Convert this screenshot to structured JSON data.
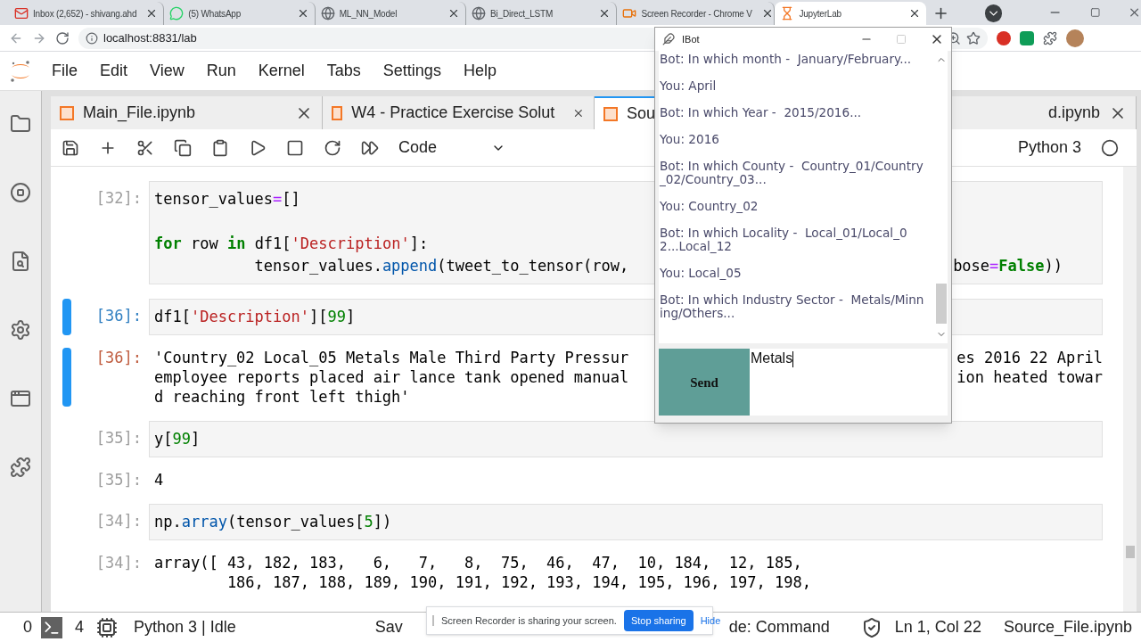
{
  "browser": {
    "tabs": [
      {
        "kind": "mail",
        "title": "Inbox (2,652) - shivang.ahd",
        "selected": false
      },
      {
        "kind": "chat",
        "title": "(5) WhatsApp",
        "selected": false
      },
      {
        "kind": "globe",
        "title": "ML_NN_Model",
        "selected": false
      },
      {
        "kind": "globe",
        "title": "Bi_Direct_LSTM",
        "selected": false
      },
      {
        "kind": "recorder",
        "title": "Screen Recorder - Chrome V",
        "selected": false
      },
      {
        "kind": "notebook",
        "title": "JupyterLab",
        "selected": true
      }
    ],
    "address": "localhost:8831/lab"
  },
  "menu": [
    "File",
    "Edit",
    "View",
    "Run",
    "Kernel",
    "Tabs",
    "Settings",
    "Help"
  ],
  "notebook_tabs": [
    {
      "label": "Main_File.ipynb",
      "selected": false
    },
    {
      "label": "W4 - Practice Exercise Solut",
      "selected": false
    },
    {
      "label": "Sou",
      "selected": true
    },
    {
      "label": "d.ipynb",
      "selected": false
    }
  ],
  "toolbar": {
    "cell_type": "Code",
    "kernel": "Python 3"
  },
  "cells": [
    {
      "kind": "input",
      "prompt": "[32]:",
      "active": false,
      "lines": [
        {
          "tokens": [
            {
              "kind": "plain",
              "text": "tensor_values"
            },
            {
              "kind": "op",
              "text": "="
            },
            {
              "kind": "plain",
              "text": "[]"
            }
          ]
        },
        {
          "blank_before": true,
          "tokens": [
            {
              "kind": "kw",
              "text": "for"
            },
            {
              "kind": "plain",
              "text": " row "
            },
            {
              "kind": "kw",
              "text": "in"
            },
            {
              "kind": "plain",
              "text": " df1["
            },
            {
              "kind": "str",
              "text": "'Description'"
            },
            {
              "kind": "plain",
              "text": "]:"
            }
          ]
        },
        {
          "tokens": [
            {
              "kind": "plain",
              "text": "           tensor_values."
            },
            {
              "kind": "attr",
              "text": "append"
            },
            {
              "kind": "plain",
              "text": "(tweet_to_tensor(row,"
            }
          ],
          "tail": [
            {
              "kind": "plain",
              "text": "bose"
            },
            {
              "kind": "op",
              "text": "="
            },
            {
              "kind": "kw",
              "text": "False"
            },
            {
              "kind": "plain",
              "text": "))"
            }
          ]
        }
      ]
    },
    {
      "kind": "input",
      "prompt": "[36]:",
      "active": true,
      "lines": [
        {
          "tokens": [
            {
              "kind": "plain",
              "text": "df1["
            },
            {
              "kind": "str",
              "text": "'Description'"
            },
            {
              "kind": "plain",
              "text": "]["
            },
            {
              "kind": "num",
              "text": "99"
            },
            {
              "kind": "plain",
              "text": "]"
            }
          ]
        }
      ]
    },
    {
      "kind": "output",
      "prompt": "[36]:",
      "active": true,
      "lines": [
        {
          "tokens": [
            {
              "kind": "plain",
              "text": "'Country_02 Local_05 Metals Male Third Party Pressur"
            }
          ],
          "tail": [
            {
              "kind": "plain",
              "text": "es 2016 22 April"
            }
          ]
        },
        {
          "tokens": [
            {
              "kind": "plain",
              "text": "employee reports placed air lance tank opened manual"
            }
          ],
          "tail": [
            {
              "kind": "plain",
              "text": "ion heated towar"
            }
          ]
        },
        {
          "tokens": [
            {
              "kind": "plain",
              "text": "d reaching front left thigh'"
            }
          ]
        }
      ]
    },
    {
      "kind": "input",
      "prompt": "[35]:",
      "active": false,
      "lines": [
        {
          "tokens": [
            {
              "kind": "plain",
              "text": "y["
            },
            {
              "kind": "num",
              "text": "99"
            },
            {
              "kind": "plain",
              "text": "]"
            }
          ]
        }
      ]
    },
    {
      "kind": "output",
      "prompt": "[35]:",
      "active": false,
      "lines": [
        {
          "tokens": [
            {
              "kind": "plain",
              "text": "4"
            }
          ]
        }
      ]
    },
    {
      "kind": "input",
      "prompt": "[34]:",
      "active": false,
      "lines": [
        {
          "tokens": [
            {
              "kind": "plain",
              "text": "np."
            },
            {
              "kind": "attr",
              "text": "array"
            },
            {
              "kind": "plain",
              "text": "(tensor_values["
            },
            {
              "kind": "num",
              "text": "5"
            },
            {
              "kind": "plain",
              "text": "])"
            }
          ]
        }
      ]
    },
    {
      "kind": "output",
      "prompt": "[34]:",
      "active": false,
      "lines": [
        {
          "tokens": [
            {
              "kind": "plain",
              "text": "array([ 43, 182, 183,   6,   7,   8,  75,  46,  47,  10, 184,  12, 185,"
            }
          ]
        },
        {
          "tokens": [
            {
              "kind": "plain",
              "text": "        186, 187, 188, 189, 190, 191, 192, 193, 194, 195, 196, 197, 198,"
            }
          ]
        }
      ]
    }
  ],
  "status_bar": {
    "terminals": "0",
    "kernels": "4",
    "kernel_status": "Python 3 | Idle",
    "saving": "Sav",
    "mode": "de: Command",
    "position": "Ln 1, Col 22",
    "file": "Source_File.ipynb"
  },
  "recorder_bar": {
    "message": "Screen Recorder is sharing your screen.",
    "stop": "Stop sharing",
    "hide": "Hide"
  },
  "chat_window": {
    "title": "IBot",
    "messages": [
      "Bot: In which month -  January/February...",
      "You: April",
      "Bot: In which Year -  2015/2016...",
      "You: 2016",
      "Bot: In which County -  Country_01/Country_02/Country_03...",
      "You: Country_02",
      "Bot: In which Locality -  Local_01/Local_02...Local_12",
      "You: Local_05",
      "Bot: In which Industry Sector -  Metals/Minning/Others..."
    ],
    "input": "Metals",
    "send": "Send"
  }
}
